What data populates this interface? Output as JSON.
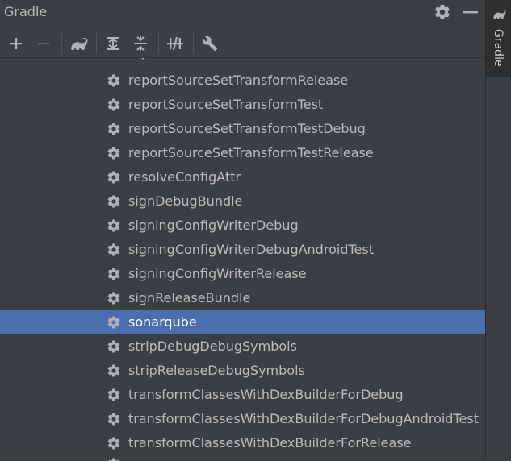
{
  "panel": {
    "title": "Gradle"
  },
  "side_tab": {
    "label": "Gradle"
  },
  "tree": {
    "tasks": [
      "reportSourceSetTransformRelease",
      "reportSourceSetTransformTest",
      "reportSourceSetTransformTestDebug",
      "reportSourceSetTransformTestRelease",
      "resolveConfigAttr",
      "signDebugBundle",
      "signingConfigWriterDebug",
      "signingConfigWriterDebugAndroidTest",
      "signingConfigWriterRelease",
      "signReleaseBundle",
      "sonarqube",
      "stripDebugDebugSymbols",
      "stripReleaseDebugSymbols",
      "transformClassesWithDexBuilderForDebug",
      "transformClassesWithDexBuilderForDebugAndroidTest",
      "transformClassesWithDexBuilderForRelease"
    ],
    "selected": "sonarqube"
  },
  "colors": {
    "background": "#3c3f41",
    "text": "#bbbbbb",
    "selection": "#4b6eaf",
    "icon": "#afb1b3"
  },
  "icons": {
    "title_settings": "gear-icon",
    "title_hide": "minimize-icon",
    "toolbar_add": "plus-icon",
    "toolbar_remove": "minus-icon",
    "toolbar_elephant": "gradle-elephant-icon",
    "toolbar_expand": "expand-all-icon",
    "toolbar_collapse": "collapse-all-icon",
    "toolbar_offline": "toggle-offline-icon",
    "toolbar_settings": "wrench-icon",
    "task": "gear-icon"
  }
}
